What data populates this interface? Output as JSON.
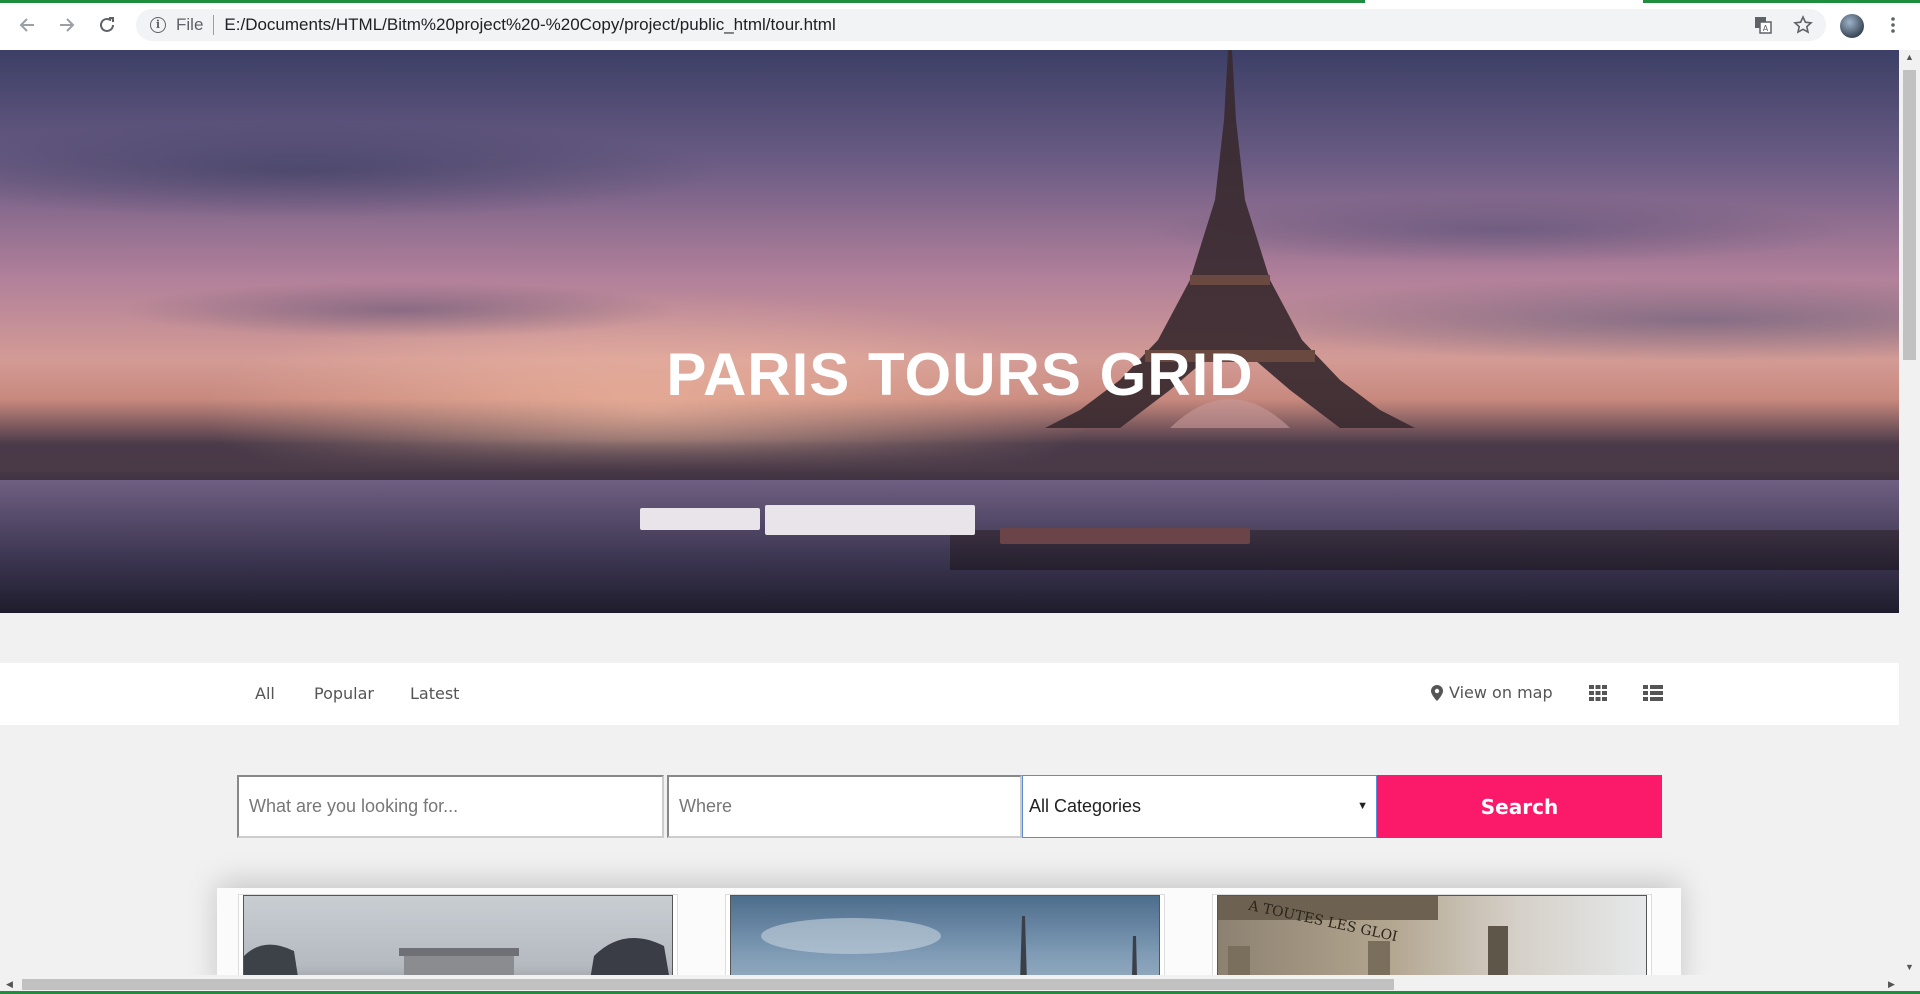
{
  "browser": {
    "protocol_label": "File",
    "url": "E:/Documents/HTML/Bitm%20project%20-%20Copy/project/public_html/tour.html",
    "icons": [
      "back-icon",
      "forward-icon",
      "reload-icon",
      "info-icon",
      "translate-icon",
      "star-icon",
      "profile-avatar",
      "menu-icon"
    ]
  },
  "hero": {
    "title": "PARIS TOURS GRID"
  },
  "filters": {
    "tabs": [
      "All",
      "Popular",
      "Latest"
    ],
    "map_label": "View on map",
    "view_icons": [
      "grid-view-icon",
      "list-view-icon"
    ]
  },
  "search": {
    "what_placeholder": "What are you looking for...",
    "where_placeholder": "Where",
    "category_value": "All Categories",
    "button_label": "Search"
  },
  "colors": {
    "accent": "#fb1a6a",
    "load_bar": "#1e8e3e",
    "select_border": "#5b8dd6"
  }
}
